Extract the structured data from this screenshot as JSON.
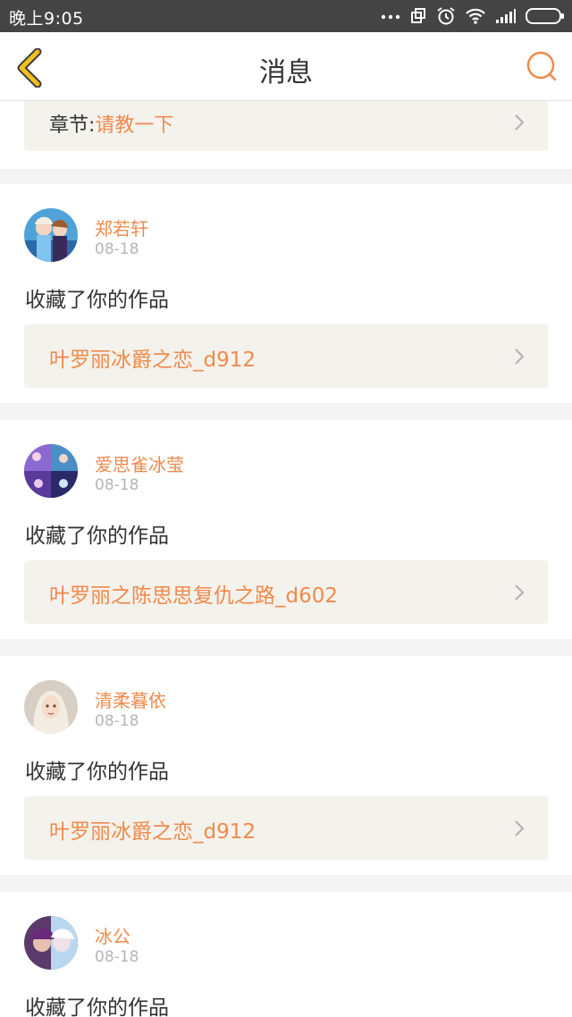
{
  "status_bar": {
    "time": "晚上9:05"
  },
  "header": {
    "title": "消息"
  },
  "colors": {
    "accent": "#f08a4b",
    "back_icon": "#f0c020",
    "card_link_bg": "#f4f2ec"
  },
  "chapter_card": {
    "label": "章节:",
    "value": "请教一下"
  },
  "messages": [
    {
      "username": "郑若轩",
      "date": "08-18",
      "action": "收藏了你的作品",
      "work_title": "叶罗丽冰爵之恋_d912"
    },
    {
      "username": "爱思雀冰莹",
      "date": "08-18",
      "action": "收藏了你的作品",
      "work_title": "叶罗丽之陈思思复仇之路_d602"
    },
    {
      "username": "清柔暮依",
      "date": "08-18",
      "action": "收藏了你的作品",
      "work_title": "叶罗丽冰爵之恋_d912"
    },
    {
      "username": "冰公",
      "date": "08-18",
      "action": "收藏了你的作品"
    }
  ]
}
